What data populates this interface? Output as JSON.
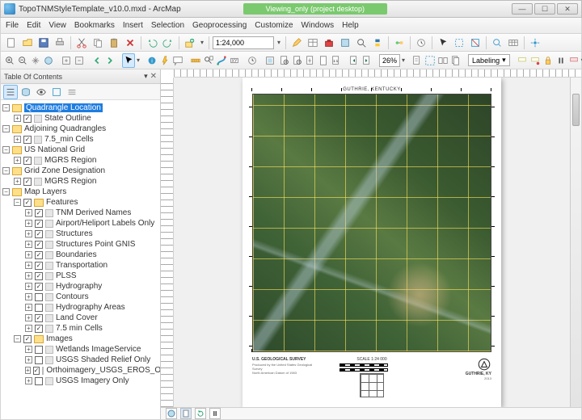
{
  "titlebar": {
    "title": "TopoTNMStyleTemplate_v10.0.mxd - ArcMap",
    "banner": "Viewing_only (project desktop)"
  },
  "menu": [
    "File",
    "Edit",
    "View",
    "Bookmarks",
    "Insert",
    "Selection",
    "Geoprocessing",
    "Customize",
    "Windows",
    "Help"
  ],
  "toolbar1": {
    "scale": "1:24,000"
  },
  "toolbar3": {
    "zoom_pct": "26%",
    "labeling": "Labeling"
  },
  "toc": {
    "title": "Table Of Contents",
    "groups": [
      {
        "label": "Quadrangle Location",
        "selected": true,
        "children": [
          {
            "label": "State Outline",
            "checked": true
          }
        ]
      },
      {
        "label": "Adjoining Quadrangles",
        "children": [
          {
            "label": "7.5_min Cells",
            "checked": true
          }
        ]
      },
      {
        "label": "US National Grid",
        "children": [
          {
            "label": "MGRS Region",
            "checked": true
          }
        ]
      },
      {
        "label": "Grid Zone Designation",
        "children": [
          {
            "label": "MGRS Region",
            "checked": true
          }
        ]
      },
      {
        "label": "Map Layers",
        "children": [
          {
            "label": "Features",
            "checked": true,
            "sub": [
              {
                "label": "TNM Derived Names",
                "checked": true
              },
              {
                "label": "Airport/Heliport Labels Only",
                "checked": true
              },
              {
                "label": "Structures",
                "checked": true
              },
              {
                "label": "Structures Point GNIS",
                "checked": true
              },
              {
                "label": "Boundaries",
                "checked": true
              },
              {
                "label": "Transportation",
                "checked": true
              },
              {
                "label": "PLSS",
                "checked": true
              },
              {
                "label": "Hydrography",
                "checked": true
              },
              {
                "label": "Contours",
                "checked": false
              },
              {
                "label": "Hydrography Areas",
                "checked": false
              },
              {
                "label": "Land Cover",
                "checked": true
              },
              {
                "label": "7.5 min Cells",
                "checked": true
              }
            ]
          },
          {
            "label": "Images",
            "checked": true,
            "sub": [
              {
                "label": "Wetlands ImageService",
                "checked": false
              },
              {
                "label": "USGS Shaded Relief Only",
                "checked": false
              },
              {
                "label": "Orthoimagery_USGS_EROS_Ortho_SCALE",
                "checked": true
              },
              {
                "label": "USGS Imagery Only",
                "checked": false
              }
            ]
          }
        ]
      }
    ]
  },
  "layout": {
    "map_title": "GUTHRIE, KENTUCKY",
    "footer_scale": "SCALE 1:24 000",
    "quad_name": "GUTHRIE, KY",
    "survey": "U.S. GEOLOGICAL SURVEY"
  },
  "icons": {
    "minimize": "—",
    "maximize": "☐",
    "close": "✕",
    "dropdown": "▾",
    "pin": "▾",
    "x": "✕"
  }
}
